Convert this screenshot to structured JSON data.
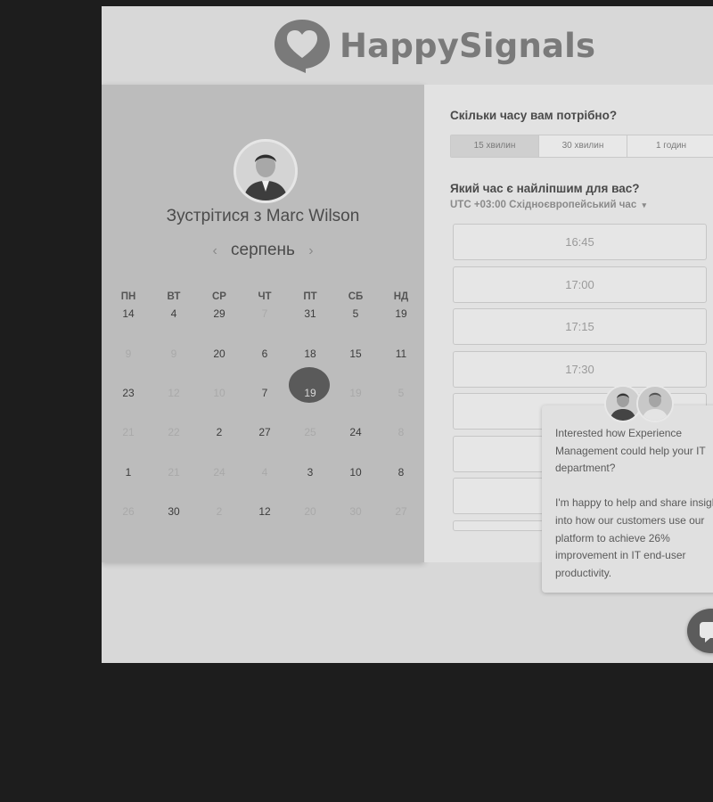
{
  "brand": {
    "name": "HappySignals"
  },
  "calendar": {
    "title": "Зустрітися з Marc Wilson",
    "month": "серпень",
    "weekdays": [
      "ПН",
      "ВТ",
      "СР",
      "ЧТ",
      "ПТ",
      "СБ",
      "НД"
    ],
    "rows": [
      [
        {
          "d": "14",
          "on": true
        },
        {
          "d": "4",
          "on": true
        },
        {
          "d": "29",
          "on": true
        },
        {
          "d": "7",
          "on": false
        },
        {
          "d": "31",
          "on": true
        },
        {
          "d": "5",
          "on": true
        },
        {
          "d": "19",
          "on": true
        }
      ],
      [
        {
          "d": "9",
          "on": false
        },
        {
          "d": "9",
          "on": false
        },
        {
          "d": "20",
          "on": true
        },
        {
          "d": "6",
          "on": true
        },
        {
          "d": "18",
          "on": true
        },
        {
          "d": "15",
          "on": true
        },
        {
          "d": "11",
          "on": true
        }
      ],
      [
        {
          "d": "23",
          "on": true
        },
        {
          "d": "12",
          "on": false
        },
        {
          "d": "10",
          "on": false
        },
        {
          "d": "7",
          "on": true
        },
        {
          "d": "19",
          "on": true,
          "selected": true
        },
        {
          "d": "19",
          "on": false
        },
        {
          "d": "5",
          "on": false
        }
      ],
      [
        {
          "d": "21",
          "on": false
        },
        {
          "d": "22",
          "on": false
        },
        {
          "d": "2",
          "on": true
        },
        {
          "d": "27",
          "on": true
        },
        {
          "d": "25",
          "on": false
        },
        {
          "d": "24",
          "on": true
        },
        {
          "d": "8",
          "on": false
        }
      ],
      [
        {
          "d": "1",
          "on": true
        },
        {
          "d": "21",
          "on": false
        },
        {
          "d": "24",
          "on": false
        },
        {
          "d": "4",
          "on": false
        },
        {
          "d": "3",
          "on": true
        },
        {
          "d": "10",
          "on": true
        },
        {
          "d": "8",
          "on": true
        }
      ],
      [
        {
          "d": "26",
          "on": false
        },
        {
          "d": "30",
          "on": true
        },
        {
          "d": "2",
          "on": false
        },
        {
          "d": "12",
          "on": true
        },
        {
          "d": "20",
          "on": false
        },
        {
          "d": "30",
          "on": false
        },
        {
          "d": "27",
          "on": false
        }
      ]
    ]
  },
  "booking": {
    "duration_question": "Скільки часу вам потрібно?",
    "durations": [
      "15 хвилин",
      "30 хвилин",
      "1 годин"
    ],
    "time_question": "Який час є найліпшим для вас?",
    "timezone": "UTC +03:00 Східноєвропейський час",
    "slots": [
      "16:45",
      "17:00",
      "17:15",
      "17:30",
      "",
      "",
      ""
    ]
  },
  "chat": {
    "message": "Interested how Experience Management could help your IT department?\n\nI'm happy to help and share insight into how our customers use our platform to achieve 26% improvement in IT end-user productivity."
  }
}
